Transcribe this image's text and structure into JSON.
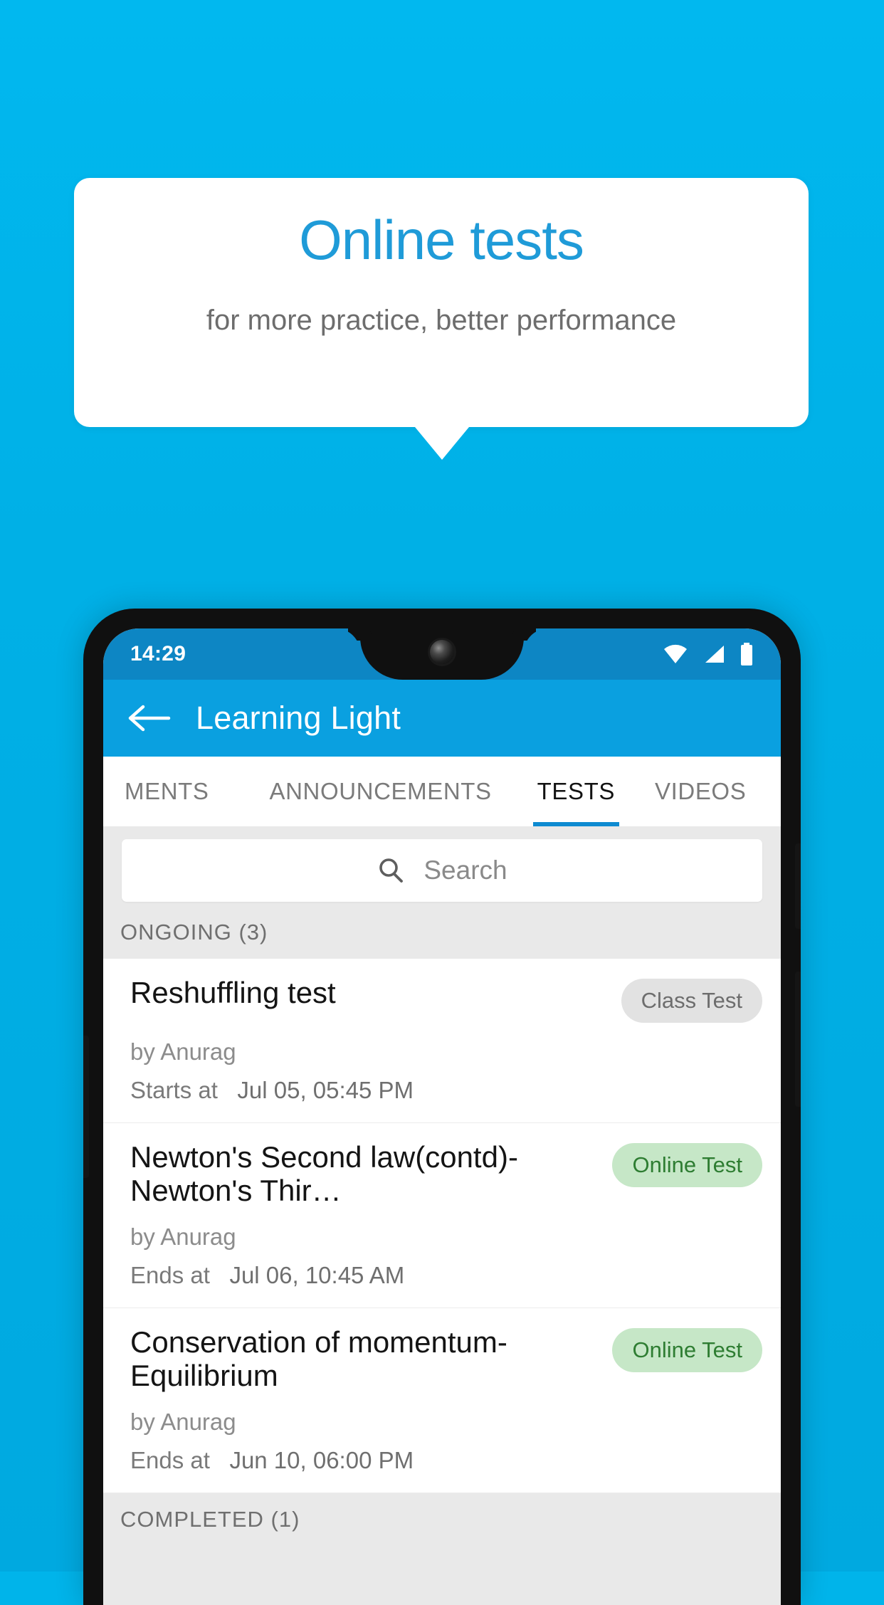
{
  "promo": {
    "title": "Online tests",
    "subtitle": "for more practice, better performance",
    "title_color": "#1f9bd8",
    "background_color": "#00b0e6"
  },
  "phone": {
    "status_bar": {
      "time": "14:29",
      "icons": [
        "wifi-icon",
        "signal-icon",
        "battery-icon"
      ],
      "background_color": "#0d86c4"
    },
    "app_bar": {
      "back_label": "back-arrow-icon",
      "title": "Learning Light",
      "background_color": "#0aa0e0"
    },
    "tabs": [
      {
        "label": "MENTS",
        "active": false
      },
      {
        "label": "ANNOUNCEMENTS",
        "active": false
      },
      {
        "label": "TESTS",
        "active": true
      },
      {
        "label": "VIDEOS",
        "active": false
      }
    ],
    "search": {
      "placeholder": "Search",
      "icon": "search-icon",
      "value": ""
    },
    "sections": [
      {
        "header": "ONGOING (3)",
        "items": [
          {
            "title": "Reshuffling test",
            "author": "by Anurag",
            "time_label": "Starts at",
            "time_value": "Jul 05, 05:45 PM",
            "badge": "Class Test",
            "badge_style": "grey"
          },
          {
            "title": "Newton's Second law(contd)-Newton's Thir…",
            "author": "by Anurag",
            "time_label": "Ends at",
            "time_value": "Jul 06, 10:45 AM",
            "badge": "Online Test",
            "badge_style": "green"
          },
          {
            "title": "Conservation of momentum-Equilibrium",
            "author": "by Anurag",
            "time_label": "Ends at",
            "time_value": "Jun 10, 06:00 PM",
            "badge": "Online Test",
            "badge_style": "green"
          }
        ]
      },
      {
        "header": "COMPLETED (1)",
        "items": []
      }
    ]
  }
}
